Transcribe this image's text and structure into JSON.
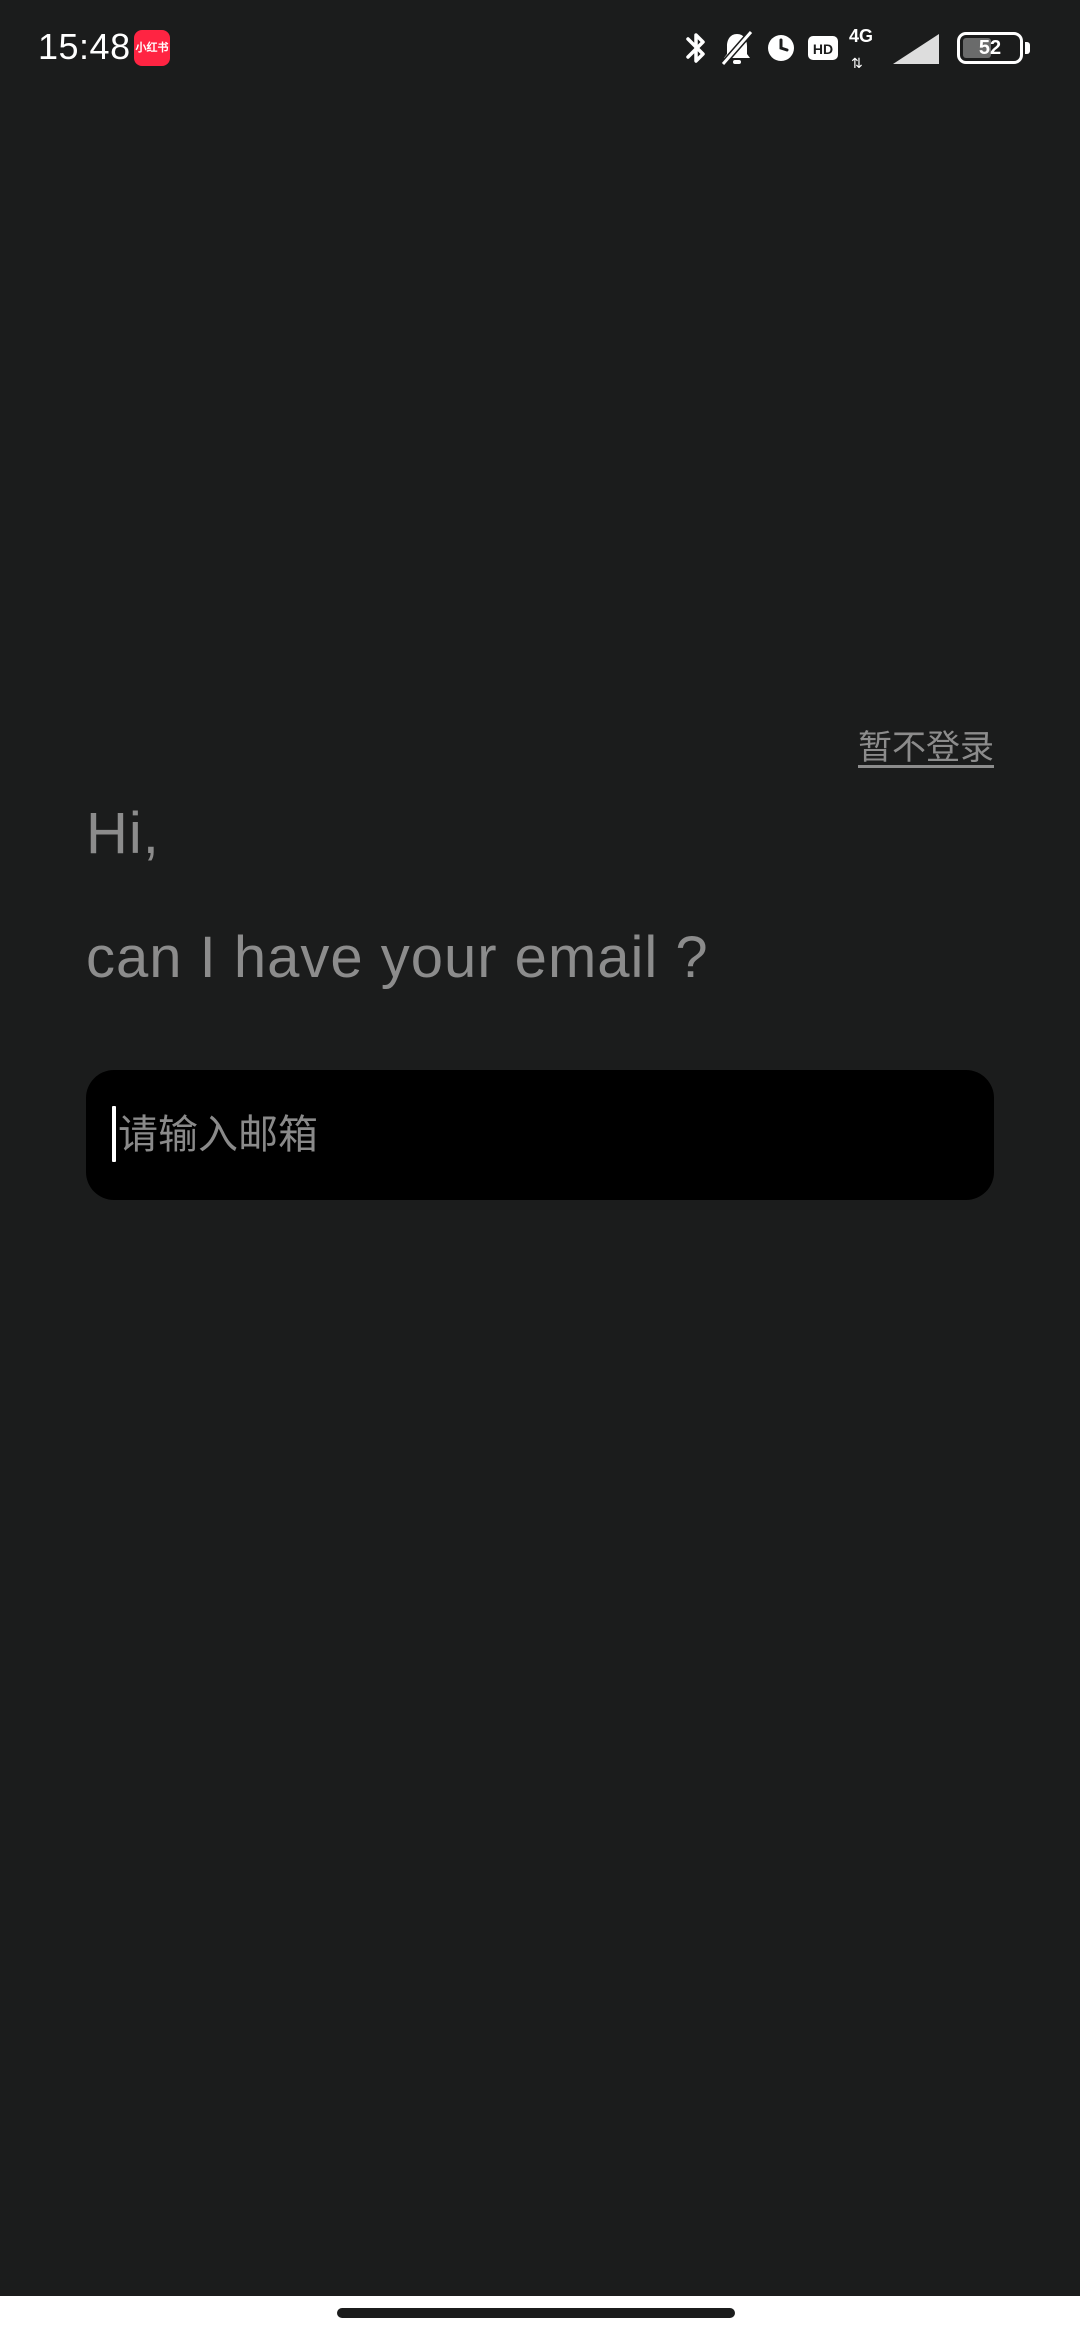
{
  "status_bar": {
    "time": "15:48",
    "app_badge_text": "小红书",
    "hd_label": "HD",
    "network_type": "4G",
    "network_arrows": "⇅",
    "battery_level": "52",
    "battery_fraction": 0.52,
    "icons": [
      "bluetooth-icon",
      "mute-icon",
      "alarm-icon",
      "hd-icon",
      "signal-icon",
      "battery-icon"
    ]
  },
  "login": {
    "skip_label": "暂不登录",
    "greeting": "Hi,",
    "prompt": "can I have your email ?",
    "email_field": {
      "value": "",
      "placeholder": "请输入邮箱"
    }
  },
  "colors": {
    "background": "#1b1c1c",
    "text_muted": "#8c8c8c",
    "input_background": "#000000",
    "badge": "#ff2442",
    "nav_bar": "#ffffff"
  }
}
